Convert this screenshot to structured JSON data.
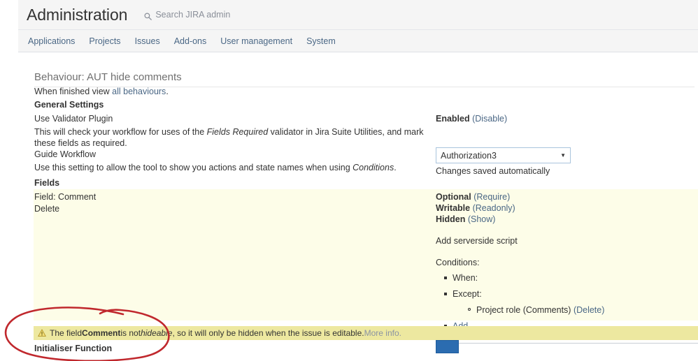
{
  "header": {
    "title": "Administration",
    "search_icon": "search-icon",
    "search_placeholder": "Search JIRA admin"
  },
  "nav": {
    "items": [
      {
        "label": "Applications"
      },
      {
        "label": "Projects"
      },
      {
        "label": "Issues"
      },
      {
        "label": "Add-ons"
      },
      {
        "label": "User management"
      },
      {
        "label": "System"
      }
    ]
  },
  "page": {
    "heading": "Behaviour: AUT hide comments",
    "finished_prefix": "When finished view ",
    "finished_link": "all behaviours",
    "finished_suffix": "."
  },
  "general_settings": {
    "heading": "General Settings",
    "validator": {
      "label": "Use Validator Plugin",
      "description_1": "This will check your workflow for uses of the ",
      "description_em": "Fields Required",
      "description_2": " validator in Jira Suite Utilities, and mark these fields as required.",
      "status": "Enabled",
      "toggle_link": "(Disable)"
    },
    "guide_workflow": {
      "label": "Guide Workflow",
      "description_1": "Use this setting to allow the tool to show you actions and state names when using ",
      "description_em": "Conditions",
      "description_2": ".",
      "selected_option": "Authorization3",
      "options": [
        "Authorization3"
      ],
      "caret_icon": "chevron-down-icon",
      "save_note": "Changes saved automatically"
    }
  },
  "fields": {
    "heading": "Fields",
    "field_label": "Field: Comment",
    "delete_link": "Delete",
    "states": [
      {
        "state": "Optional",
        "action": "(Require)"
      },
      {
        "state": "Writable",
        "action": "(Readonly)"
      },
      {
        "state": "Hidden",
        "action": "(Show)"
      }
    ],
    "add_script_link": "Add serverside script",
    "conditions_label": "Conditions:",
    "conditions": [
      {
        "label": "When:"
      },
      {
        "label": "Except:",
        "children": [
          {
            "label": "Project role (Comments) ",
            "action": "(Delete)"
          }
        ]
      }
    ],
    "add_link": "Add"
  },
  "warning": {
    "icon": "warning-triangle-icon",
    "text_1": "The field ",
    "bold": "Comment",
    "text_2": " is not ",
    "italic": "hideable",
    "text_3": ", so it will only be hidden when the issue is editable. ",
    "more_info": "More info."
  },
  "initialiser": {
    "heading": "Initialiser Function",
    "button_label": ""
  },
  "annotation": {
    "shape": "red-ellipse-highlight",
    "color": "#c0282d"
  },
  "colors": {
    "header_bg": "#f5f5f5",
    "link": "#4a6785",
    "panel_yellow": "#fdfde8",
    "warning_yellow": "#ede8a0",
    "button_blue": "#2b6cb0",
    "annotation_red": "#c0282d"
  }
}
